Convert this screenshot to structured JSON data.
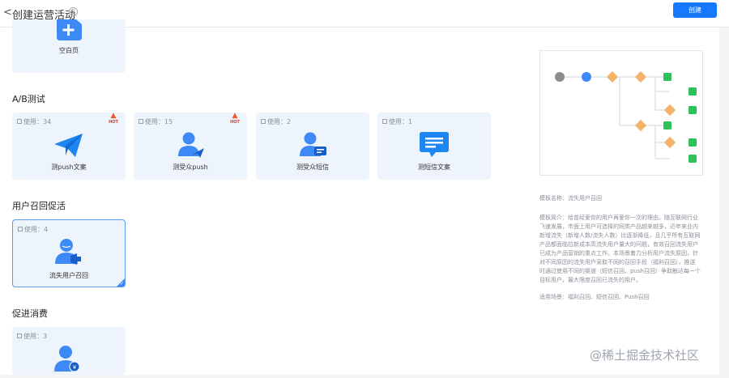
{
  "header": {
    "title": "创建运营活动",
    "back_glyph": "<",
    "help_glyph": "?",
    "create_label": "创建"
  },
  "cards": {
    "blank": {
      "label": "空白页"
    },
    "ab_title": "A/B测试",
    "ab": [
      {
        "usage": "使用：34",
        "hot": "HOT",
        "label": "测push文案"
      },
      {
        "usage": "使用：15",
        "hot": "HOT",
        "label": "测受众push"
      },
      {
        "usage": "使用：2",
        "label": "测受众短信"
      },
      {
        "usage": "使用：1",
        "label": "测短信文案"
      }
    ],
    "recall_title": "用户召回促活",
    "recall": [
      {
        "usage": "使用：4",
        "label": "流失用户召回"
      }
    ],
    "consume_title": "促进消费",
    "consume": [
      {
        "usage": "使用：3"
      }
    ]
  },
  "side": {
    "template_name": "模板名称：流失用户召回",
    "intro_lines": [
      "模板简介：给曾经爱你的用户再爱你一次的理由。随互联网行业",
      "飞速发展，市面上用户可选择的同类产品越来越多，近年来业内",
      "新增流失（新增人数/流失人数）比逐渐降低，且几乎所有互联网",
      "产品都面临拉新成本高流失用户量大的问题，有效召回流失用户",
      "已成为产品营销的重点工作。本场景着力分析用户流失原因，针",
      "对不同原因的流失用户采取不同的召回手段（福利召回），推送",
      "时通过使用不同的渠道（短信召回、push召回）争取触达每一个",
      "目标用户，最大限度召回已流失的用户。"
    ],
    "scenes": "适用场景：福利召回、短信召回、Push召回"
  },
  "watermark": "@稀土掘金技术社区",
  "colors": {
    "primary": "#1677ff",
    "card_bg": "#eef4fb",
    "icon_blue": "#3d8af7",
    "hot_red": "#e2362b",
    "flow_orange": "#f3b36a",
    "flow_green": "#2fc25b"
  }
}
